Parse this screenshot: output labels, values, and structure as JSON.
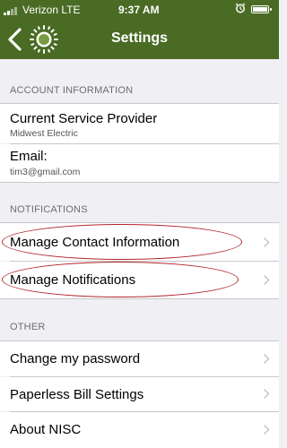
{
  "status_bar": {
    "carrier": "Verizon  LTE",
    "time": "9:37 AM"
  },
  "nav": {
    "title": "Settings"
  },
  "sections": {
    "account": {
      "header": "ACCOUNT INFORMATION",
      "provider_label": "Current Service Provider",
      "provider_value": "Midwest Electric",
      "email_label": "Email:",
      "email_value": "tim3@gmail.com"
    },
    "notifications": {
      "header": "NOTIFICATIONS",
      "items": [
        {
          "label": "Manage Contact Information"
        },
        {
          "label": "Manage Notifications"
        }
      ]
    },
    "other": {
      "header": "OTHER",
      "items": [
        {
          "label": "Change my password"
        },
        {
          "label": "Paperless Bill Settings"
        },
        {
          "label": "About NISC"
        }
      ]
    }
  },
  "colors": {
    "nav_green": "#4a6b24",
    "highlight_red": "#b4262a",
    "group_background": "#efeff4"
  },
  "annotations": {
    "circled_items": [
      "Manage Contact Information",
      "Manage Notifications"
    ]
  }
}
